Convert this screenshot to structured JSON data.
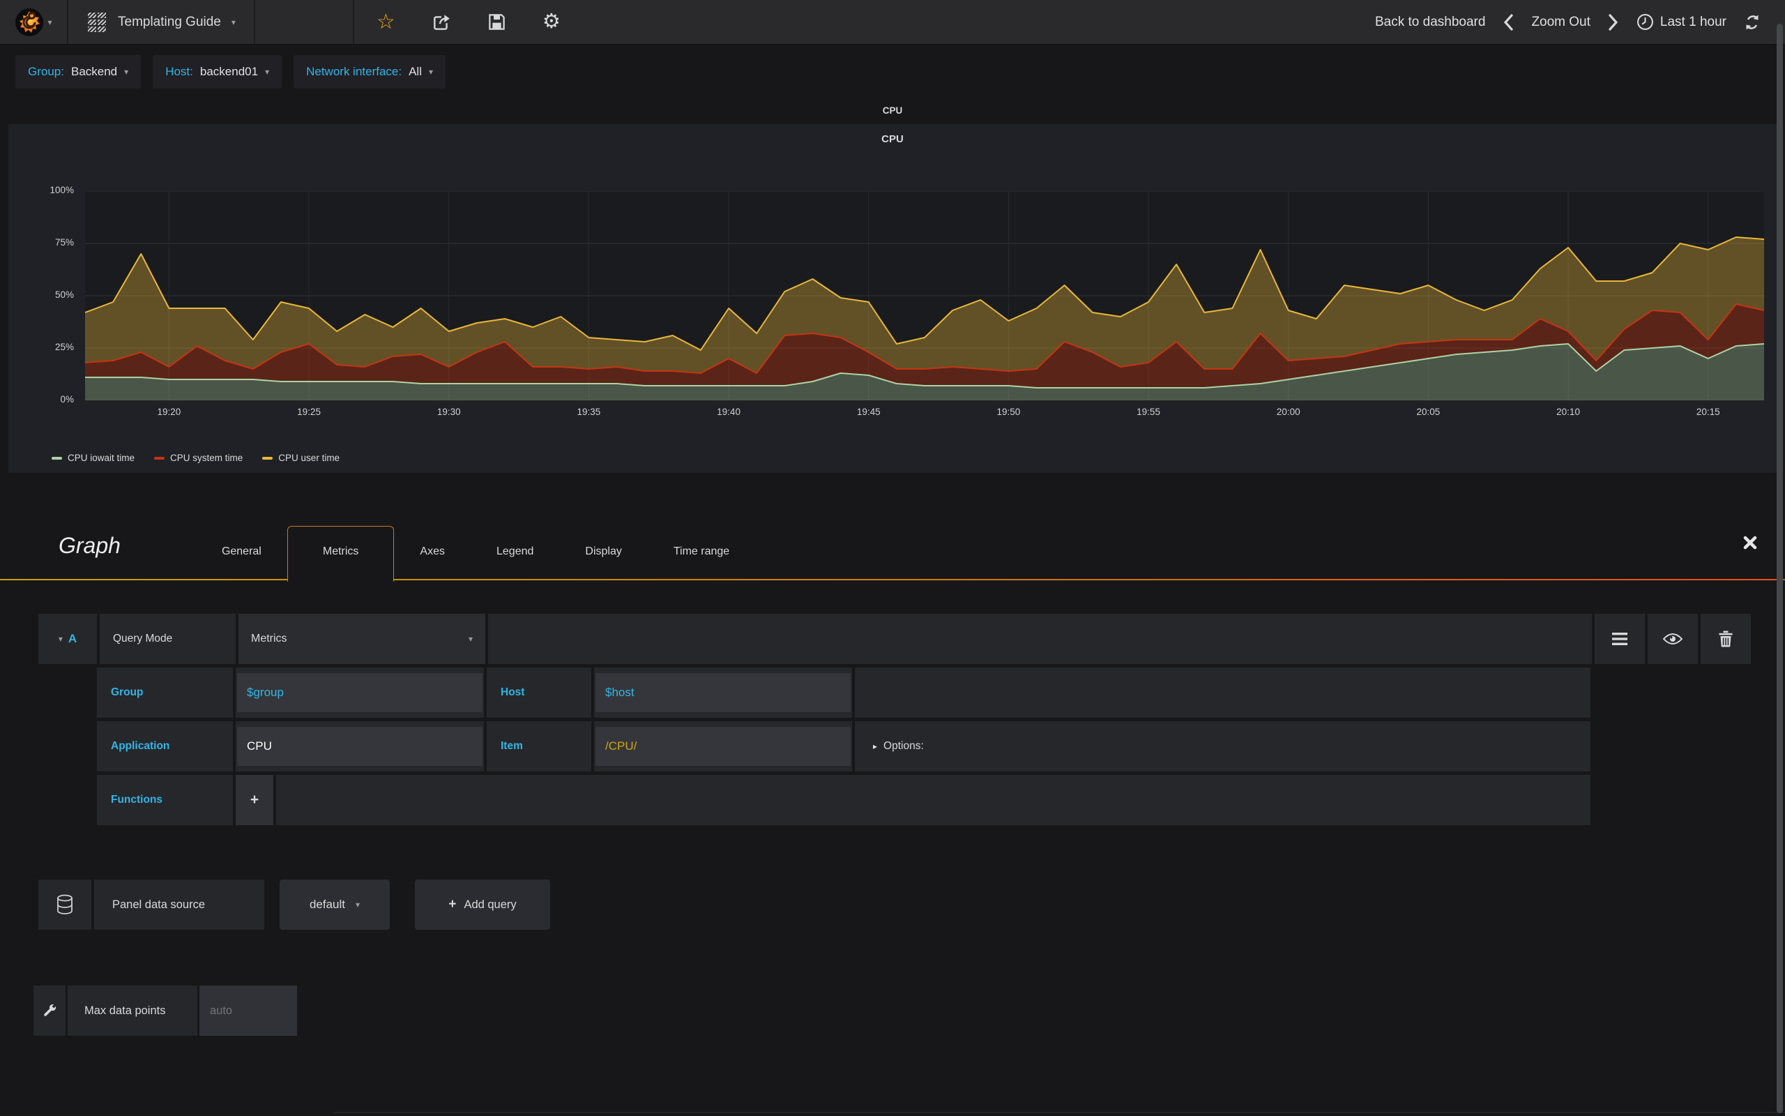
{
  "navbar": {
    "title": "Templating Guide",
    "back_to_dashboard": "Back to dashboard",
    "zoom_out": "Zoom Out",
    "time_range": "Last 1 hour"
  },
  "icons": {
    "caret_down": "▾",
    "caret_right": "▸",
    "star": "☆",
    "gear": "⚙",
    "plus": "+"
  },
  "variables": [
    {
      "label": "Group:",
      "value": "Backend"
    },
    {
      "label": "Host:",
      "value": "backend01"
    },
    {
      "label": "Network interface:",
      "value": "All"
    }
  ],
  "row_title": "CPU",
  "panel_title": "CPU",
  "chart_data": {
    "type": "area",
    "stacked": true,
    "title": "CPU",
    "grid": true,
    "legend_position": "bottom-left",
    "x_range": [
      "19:17",
      "20:17"
    ],
    "x_step_minutes": 1,
    "ylim": [
      0,
      100
    ],
    "yticks": [
      {
        "label": "0%",
        "value": 0
      },
      {
        "label": "25%",
        "value": 25
      },
      {
        "label": "50%",
        "value": 50
      },
      {
        "label": "75%",
        "value": 75
      },
      {
        "label": "100%",
        "value": 100
      }
    ],
    "xticks": [
      {
        "label": "19:20",
        "minute": 3
      },
      {
        "label": "19:25",
        "minute": 8
      },
      {
        "label": "19:30",
        "minute": 13
      },
      {
        "label": "19:35",
        "minute": 18
      },
      {
        "label": "19:40",
        "minute": 23
      },
      {
        "label": "19:45",
        "minute": 28
      },
      {
        "label": "19:50",
        "minute": 33
      },
      {
        "label": "19:55",
        "minute": 38
      },
      {
        "label": "20:00",
        "minute": 43
      },
      {
        "label": "20:05",
        "minute": 48
      },
      {
        "label": "20:10",
        "minute": 53
      },
      {
        "label": "20:15",
        "minute": 58
      }
    ],
    "series": [
      {
        "name": "CPU iowait time",
        "color": "#aed3a3",
        "fill": "rgba(174,211,163,0.32)",
        "values": [
          11,
          11,
          11,
          10,
          10,
          10,
          10,
          9,
          9,
          9,
          9,
          9,
          8,
          8,
          8,
          8,
          8,
          8,
          8,
          8,
          7,
          7,
          7,
          7,
          7,
          7,
          9,
          13,
          12,
          8,
          7,
          7,
          7,
          7,
          6,
          6,
          6,
          6,
          6,
          6,
          6,
          7,
          8,
          10,
          12,
          14,
          16,
          18,
          20,
          22,
          23,
          24,
          26,
          27,
          14,
          24,
          25,
          26,
          20,
          26,
          27
        ]
      },
      {
        "name": "CPU system time",
        "color": "#c43512",
        "fill": "rgba(196,53,18,0.38)",
        "values": [
          7,
          8,
          12,
          6,
          16,
          9,
          5,
          14,
          18,
          8,
          7,
          12,
          14,
          8,
          15,
          20,
          8,
          8,
          7,
          8,
          7,
          7,
          6,
          13,
          6,
          24,
          23,
          17,
          11,
          7,
          8,
          9,
          8,
          7,
          9,
          22,
          17,
          10,
          12,
          22,
          9,
          8,
          24,
          9,
          8,
          7,
          8,
          9,
          8,
          7,
          6,
          5,
          13,
          6,
          5,
          10,
          18,
          16,
          9,
          20,
          16
        ]
      },
      {
        "name": "CPU user time",
        "color": "#eab839",
        "fill": "rgba(234,184,57,0.35)",
        "values": [
          24,
          28,
          47,
          28,
          18,
          25,
          14,
          24,
          17,
          16,
          25,
          14,
          22,
          17,
          14,
          11,
          19,
          24,
          15,
          13,
          14,
          17,
          11,
          24,
          19,
          21,
          26,
          19,
          24,
          12,
          15,
          27,
          33,
          24,
          29,
          27,
          19,
          24,
          29,
          37,
          27,
          29,
          40,
          24,
          19,
          34,
          29,
          24,
          27,
          19,
          14,
          19,
          24,
          40,
          38,
          23,
          18,
          33,
          43,
          32,
          34
        ]
      }
    ]
  },
  "editor": {
    "panel_type": "Graph",
    "tabs": [
      {
        "label": "General",
        "active": false
      },
      {
        "label": "Metrics",
        "active": true
      },
      {
        "label": "Axes",
        "active": false
      },
      {
        "label": "Legend",
        "active": false
      },
      {
        "label": "Display",
        "active": false
      },
      {
        "label": "Time range",
        "active": false
      }
    ]
  },
  "query": {
    "ref": "A",
    "mode_label": "Query Mode",
    "mode_value": "Metrics",
    "group_label": "Group",
    "group_value": "$group",
    "host_label": "Host",
    "host_value": "$host",
    "application_label": "Application",
    "application_value": "CPU",
    "item_label": "Item",
    "item_value": "/CPU/",
    "options_label": "Options:",
    "functions_label": "Functions"
  },
  "datasource": {
    "label": "Panel data source",
    "value": "default",
    "add_query_label": "Add query"
  },
  "footer": {
    "max_data_points_label": "Max data points",
    "max_data_points_placeholder": "auto"
  },
  "colors": {
    "accent_blue": "#33b5e5",
    "item_yellow": "#cfa50e",
    "star_orange": "#f2a41c",
    "tab_gradient_start": "#c9a100",
    "tab_gradient_end": "#e2500f"
  }
}
